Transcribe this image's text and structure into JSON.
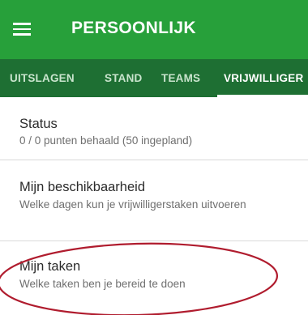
{
  "header": {
    "title": "PERSOONLIJK",
    "background_color": "#27a03a",
    "menu_icon": "hamburger-menu-icon"
  },
  "tabs": {
    "background_color": "#1e6f33",
    "items": [
      {
        "label": "UITSLAGEN",
        "active": false
      },
      {
        "label": "STAND",
        "active": false
      },
      {
        "label": "TEAMS",
        "active": false
      },
      {
        "label": "VRIJWILLIGER",
        "active": true
      }
    ]
  },
  "list": {
    "items": [
      {
        "title": "Status",
        "subtitle": "0 / 0 punten behaald (50 ingepland)"
      },
      {
        "title": "Mijn beschikbaarheid",
        "subtitle": "Welke dagen kun je vrijwilligerstaken uitvoeren"
      },
      {
        "title": "Mijn taken",
        "subtitle": "Welke taken ben je bereid te doen"
      }
    ]
  },
  "annotation": {
    "type": "ellipse",
    "color": "#b01c2e",
    "highlights": "Mijn taken"
  }
}
